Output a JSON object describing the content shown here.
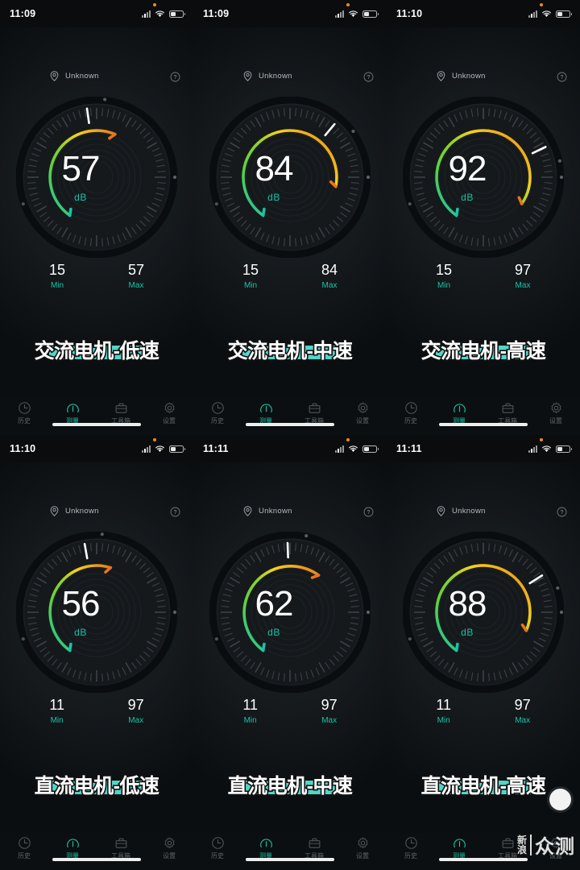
{
  "app": {
    "location_label": "Unknown",
    "unit": "dB",
    "min_label": "Min",
    "max_label": "Max",
    "accent_color": "#19c3a6",
    "highlight_color": "#4fd6c8",
    "arc_colors": [
      "#19c3a6",
      "#5fd23d",
      "#8fd32a",
      "#f3d21c",
      "#f0a81a",
      "#e8741c"
    ]
  },
  "tabs": [
    {
      "label": "历史",
      "icon": "history-clock-icon",
      "active": false
    },
    {
      "label": "测量",
      "icon": "gauge-meter-icon",
      "active": true
    },
    {
      "label": "工具箱",
      "icon": "toolbox-icon",
      "active": false
    },
    {
      "label": "设置",
      "icon": "gear-icon",
      "active": false
    }
  ],
  "watermark": {
    "brand_top": "新",
    "brand_bottom": "浪",
    "name": "众测"
  },
  "panels": [
    {
      "time": "11:09",
      "value": "57",
      "min": "15",
      "max": "57",
      "caption": "交流电机-低速",
      "needle_deg": -8,
      "arc_end": 0.58
    },
    {
      "time": "11:09",
      "value": "84",
      "min": "15",
      "max": "84",
      "caption": "交流电机-中速",
      "needle_deg": 40,
      "arc_end": 0.85
    },
    {
      "time": "11:10",
      "value": "92",
      "min": "15",
      "max": "97",
      "caption": "交流电机-高速",
      "needle_deg": 64,
      "arc_end": 0.93
    },
    {
      "time": "11:10",
      "value": "56",
      "min": "11",
      "max": "97",
      "caption": "直流电机-低速",
      "needle_deg": -10,
      "arc_end": 0.56
    },
    {
      "time": "11:11",
      "value": "62",
      "min": "11",
      "max": "97",
      "caption": "直流电机-中速",
      "needle_deg": -2,
      "arc_end": 0.63
    },
    {
      "time": "11:11",
      "value": "88",
      "min": "11",
      "max": "97",
      "caption": "直流电机-高速",
      "needle_deg": 58,
      "arc_end": 0.89
    }
  ]
}
